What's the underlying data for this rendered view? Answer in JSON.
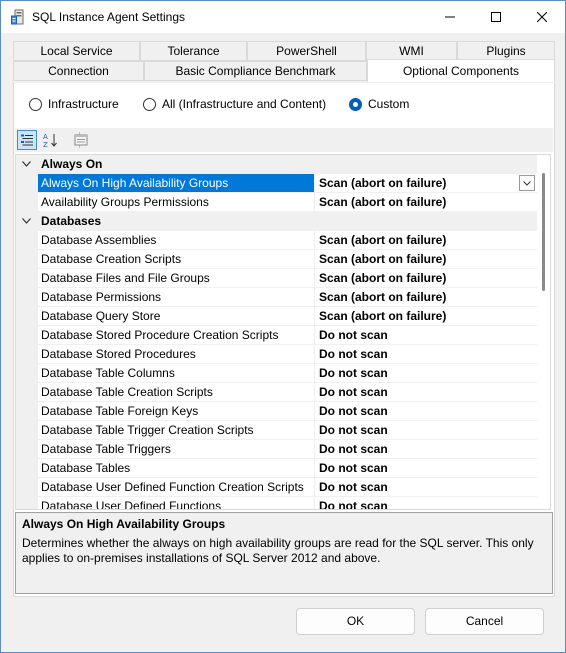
{
  "window": {
    "title": "SQL Instance Agent Settings",
    "app_icon": "server-icon",
    "controls": [
      "minimize-icon",
      "maximize-icon",
      "close-icon"
    ]
  },
  "tabs": {
    "row1": [
      "Local Service",
      "Tolerance",
      "PowerShell",
      "WMI",
      "Plugins"
    ],
    "row2": [
      "Connection",
      "Basic Compliance Benchmark",
      "Optional Components"
    ],
    "active": "Optional Components"
  },
  "scope": {
    "options": [
      "Infrastructure",
      "All (Infrastructure and Content)",
      "Custom"
    ],
    "selected": "Custom"
  },
  "toolbar": {
    "buttons": [
      "categorized-icon",
      "alphabetical-icon",
      "property-pages-icon"
    ],
    "active": "categorized-icon"
  },
  "grid": {
    "categories": [
      {
        "name": "Always On",
        "items": [
          {
            "name": "Always On High Availability Groups",
            "value": "Scan (abort on failure)"
          },
          {
            "name": "Availability Groups Permissions",
            "value": "Scan (abort on failure)"
          }
        ]
      },
      {
        "name": "Databases",
        "items": [
          {
            "name": "Database Assemblies",
            "value": "Scan (abort on failure)"
          },
          {
            "name": "Database Creation Scripts",
            "value": "Scan (abort on failure)"
          },
          {
            "name": "Database Files and File Groups",
            "value": "Scan (abort on failure)"
          },
          {
            "name": "Database Permissions",
            "value": "Scan (abort on failure)"
          },
          {
            "name": "Database Query Store",
            "value": "Scan (abort on failure)"
          },
          {
            "name": "Database Stored Procedure Creation Scripts",
            "value": "Do not scan"
          },
          {
            "name": "Database Stored Procedures",
            "value": "Do not scan"
          },
          {
            "name": "Database Table Columns",
            "value": "Do not scan"
          },
          {
            "name": "Database Table Creation Scripts",
            "value": "Do not scan"
          },
          {
            "name": "Database Table Foreign Keys",
            "value": "Do not scan"
          },
          {
            "name": "Database Table Trigger Creation Scripts",
            "value": "Do not scan"
          },
          {
            "name": "Database Table Triggers",
            "value": "Do not scan"
          },
          {
            "name": "Database Tables",
            "value": "Do not scan"
          },
          {
            "name": "Database User Defined Function Creation Scripts",
            "value": "Do not scan"
          },
          {
            "name": "Database User Defined Functions",
            "value": "Do not scan"
          }
        ]
      }
    ],
    "selected": "Always On High Availability Groups"
  },
  "description": {
    "title": "Always On High Availability Groups",
    "text": "Determines whether the always on high availability groups are read for the SQL server. This only applies to on-premises installations of SQL Server 2012 and above."
  },
  "buttons": {
    "ok": "OK",
    "cancel": "Cancel"
  },
  "colors": {
    "selection": "#0078d7",
    "radio_accent": "#005fb8"
  }
}
